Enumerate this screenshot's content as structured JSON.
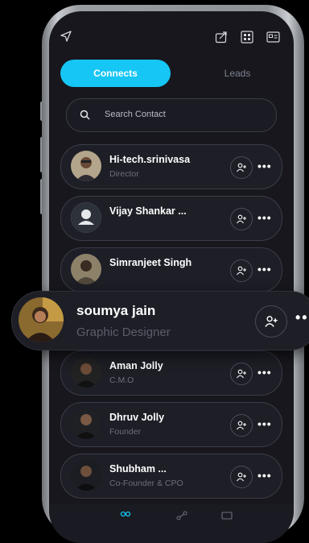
{
  "tabs": {
    "connects": "Connects",
    "leads": "Leads"
  },
  "search": {
    "placeholder": "Search Contact"
  },
  "contacts": [
    {
      "name": "Hi-tech.srinivasa",
      "role": "Director"
    },
    {
      "name": "Vijay Shankar ...",
      "role": ""
    },
    {
      "name": "Simranjeet Singh",
      "role": ""
    },
    {
      "name": "Aman Jolly",
      "role": "C.M.O"
    },
    {
      "name": "Dhruv Jolly",
      "role": "Founder"
    },
    {
      "name": "Shubham ...",
      "role": "Co-Founder & CPO"
    }
  ],
  "highlighted": {
    "name": "soumya jain",
    "role": "Graphic Designer"
  },
  "colors": {
    "accent": "#16c6f5",
    "background": "#17171d",
    "card": "#1d1e26"
  },
  "icons": [
    "send-icon",
    "share-icon",
    "qr-code-icon",
    "id-card-icon",
    "search-icon",
    "add-contact-icon",
    "more-icon",
    "contacts-nav-icon",
    "network-nav-icon",
    "card-nav-icon"
  ]
}
